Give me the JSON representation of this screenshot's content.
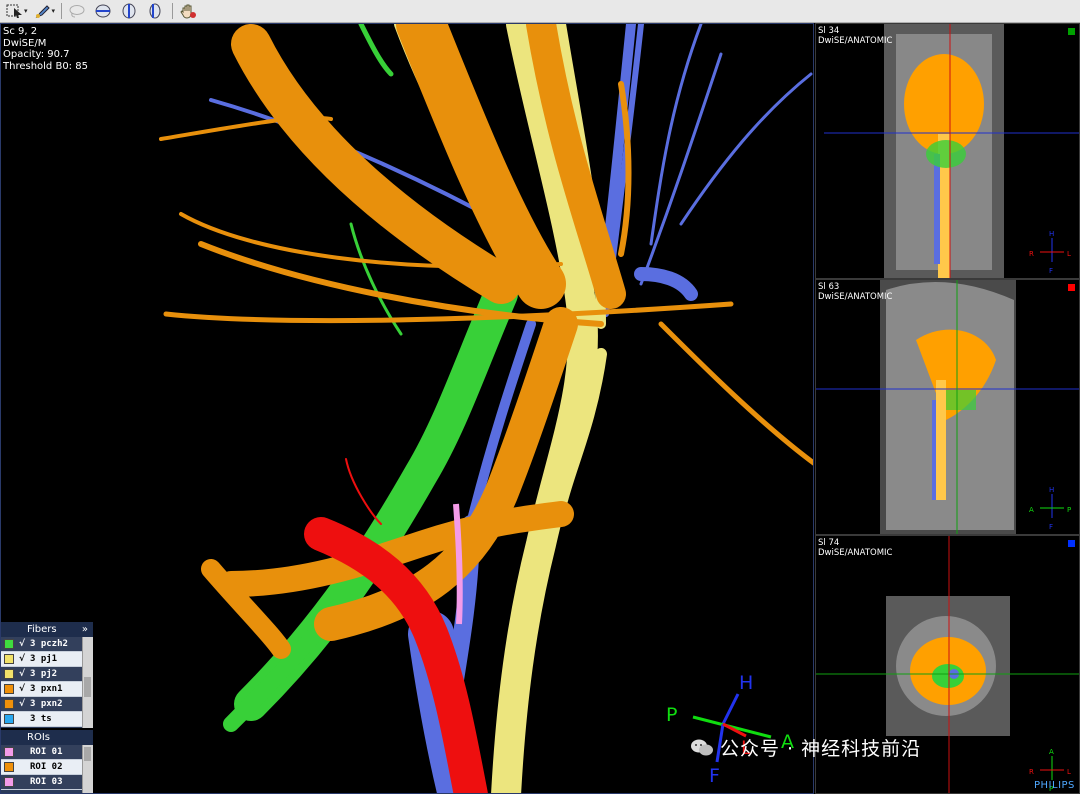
{
  "overlay": {
    "line1": "Sc 9, 2",
    "line2": "DwiSE/M",
    "line3": "Opacity: 90.7",
    "line4": "Threshold B0: 85"
  },
  "orientation": {
    "h": "H",
    "p": "P",
    "a": "A",
    "l": "L",
    "f": "F"
  },
  "views": [
    {
      "slice": "Sl 34",
      "series": "DwiSE/ANATOMIC",
      "marker_color": "#00a000",
      "o_top": "H",
      "o_left": "R",
      "o_right": "L",
      "o_bottom": "F"
    },
    {
      "slice": "Sl 63",
      "series": "DwiSE/ANATOMIC",
      "marker_color": "#ff0000",
      "o_top": "H",
      "o_left": "A",
      "o_right": "P",
      "o_bottom": "F"
    },
    {
      "slice": "Sl 74",
      "series": "DwiSE/ANATOMIC",
      "marker_color": "#0030ff",
      "o_top": "A",
      "o_left": "R",
      "o_right": "L",
      "o_bottom": "P"
    }
  ],
  "fibers_panel": {
    "title": "Fibers",
    "expand": "»",
    "items": [
      {
        "label": "3 pczh2",
        "color": "#3fdc3f",
        "checked": "√"
      },
      {
        "label": "3 pj1",
        "color": "#f2e26a",
        "checked": "√"
      },
      {
        "label": "3 pj2",
        "color": "#f2e26a",
        "checked": "√"
      },
      {
        "label": "3 pxn1",
        "color": "#f0900a",
        "checked": "√"
      },
      {
        "label": "3 pxn2",
        "color": "#f0900a",
        "checked": "√"
      },
      {
        "label": "3 ts",
        "color": "#29a8f0",
        "checked": ""
      }
    ]
  },
  "rois_panel": {
    "title": "ROIs",
    "items": [
      {
        "label": "ROI 01",
        "color": "#f49be8"
      },
      {
        "label": "ROI 02",
        "color": "#f0900a"
      },
      {
        "label": "ROI 03",
        "color": "#f49be8"
      }
    ]
  },
  "watermark": "公众号 · 神经科技前沿",
  "vendor": "PHILIPS",
  "toolbar_icons": [
    "select-tool-icon",
    "paint-tool-icon",
    "lasso-icon",
    "axial-view-icon",
    "coronal-view-icon",
    "sagittal-view-icon",
    "hand-pan-icon"
  ]
}
